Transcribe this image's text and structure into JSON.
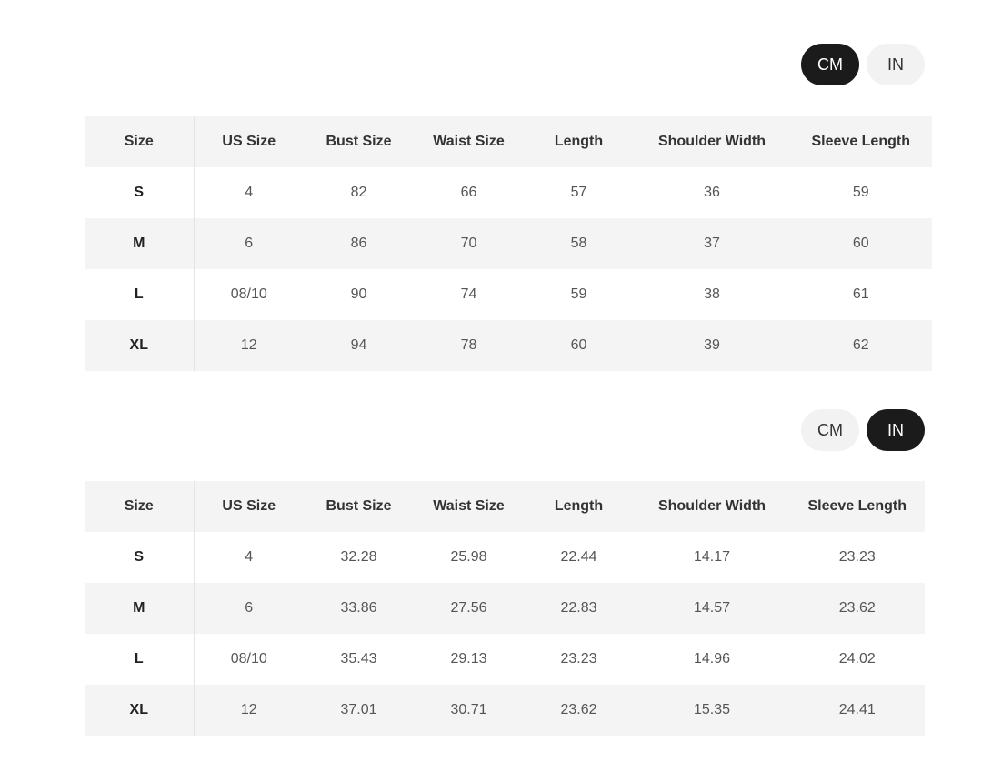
{
  "units": {
    "cm": "CM",
    "in": "IN"
  },
  "headers": [
    "Size",
    "US Size",
    "Bust Size",
    "Waist Size",
    "Length",
    "Shoulder Width",
    "Sleeve Length"
  ],
  "cm_table": {
    "active_unit": "CM",
    "rows": [
      [
        "S",
        "4",
        "82",
        "66",
        "57",
        "36",
        "59"
      ],
      [
        "M",
        "6",
        "86",
        "70",
        "58",
        "37",
        "60"
      ],
      [
        "L",
        "08/10",
        "90",
        "74",
        "59",
        "38",
        "61"
      ],
      [
        "XL",
        "12",
        "94",
        "78",
        "60",
        "39",
        "62"
      ]
    ]
  },
  "in_table": {
    "active_unit": "IN",
    "rows": [
      [
        "S",
        "4",
        "32.28",
        "25.98",
        "22.44",
        "14.17",
        "23.23"
      ],
      [
        "M",
        "6",
        "33.86",
        "27.56",
        "22.83",
        "14.57",
        "23.62"
      ],
      [
        "L",
        "08/10",
        "35.43",
        "29.13",
        "23.23",
        "14.96",
        "24.02"
      ],
      [
        "XL",
        "12",
        "37.01",
        "30.71",
        "23.62",
        "15.35",
        "24.41"
      ]
    ]
  }
}
